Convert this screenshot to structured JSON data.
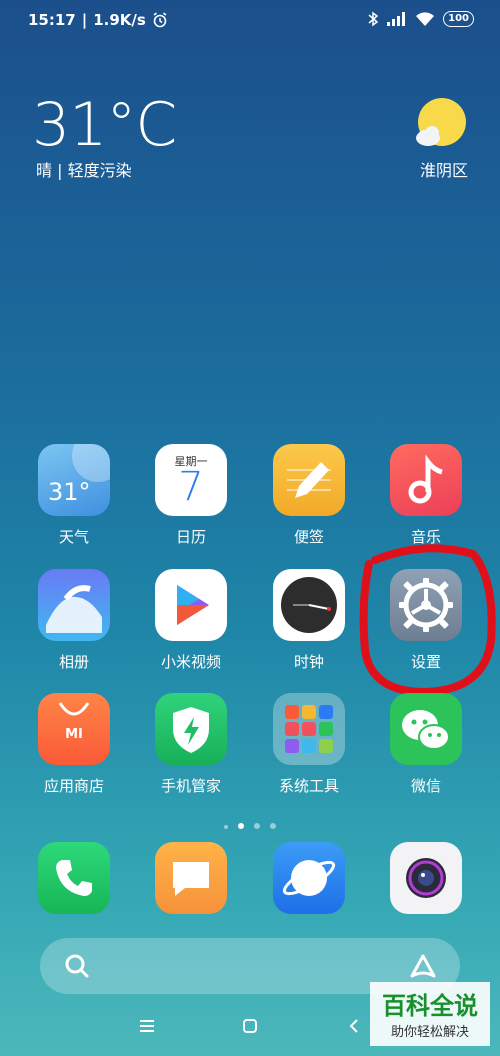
{
  "status": {
    "time": "15:17",
    "speed": "1.9K/s",
    "battery": "100"
  },
  "weather": {
    "temp": "31°C",
    "desc": "晴 | 轻度污染",
    "district": "淮阴区"
  },
  "apps": [
    {
      "label": "天气",
      "icon": "weather-icon",
      "text": "31°"
    },
    {
      "label": "日历",
      "icon": "calendar-icon",
      "weekday": "星期一",
      "day": "7"
    },
    {
      "label": "便签",
      "icon": "notes-icon"
    },
    {
      "label": "音乐",
      "icon": "music-icon"
    },
    {
      "label": "相册",
      "icon": "gallery-icon"
    },
    {
      "label": "小米视频",
      "icon": "video-icon"
    },
    {
      "label": "时钟",
      "icon": "clock-icon"
    },
    {
      "label": "设置",
      "icon": "settings-icon"
    },
    {
      "label": "应用商店",
      "icon": "app-store-icon",
      "text": "MI"
    },
    {
      "label": "手机管家",
      "icon": "security-icon"
    },
    {
      "label": "系统工具",
      "icon": "folder-icon"
    },
    {
      "label": "微信",
      "icon": "wechat-icon"
    }
  ],
  "dock": [
    {
      "icon": "phone-icon"
    },
    {
      "icon": "messages-icon"
    },
    {
      "icon": "browser-icon"
    },
    {
      "icon": "camera-icon"
    }
  ],
  "watermark": {
    "title": "百科全说",
    "subtitle": "助你轻松解决"
  },
  "colors": {
    "highlight": "#e0101a",
    "weather_bg": "#54a7ea",
    "notes_bg": "#f6b733",
    "music_bg": "#f0515a",
    "settings_bg": "#7e8fa4",
    "store_bg": "#fb6b3f",
    "security_bg": "#24c36b",
    "wechat_bg": "#2bc35a",
    "phone_bg": "#21c460"
  }
}
